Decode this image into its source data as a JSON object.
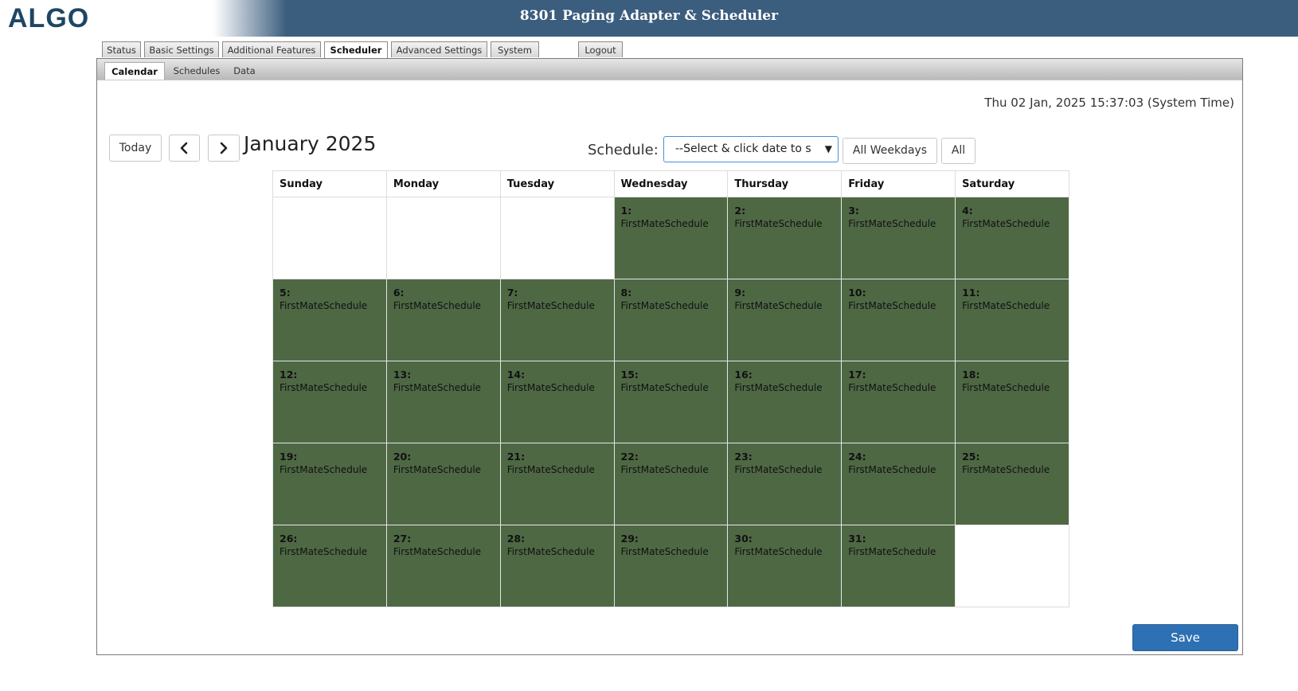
{
  "header": {
    "logo": "ALGO",
    "title": "8301 Paging Adapter & Scheduler"
  },
  "main_tabs": [
    {
      "label": "Status",
      "active": false
    },
    {
      "label": "Basic Settings",
      "active": false
    },
    {
      "label": "Additional Features",
      "active": false
    },
    {
      "label": "Scheduler",
      "active": true
    },
    {
      "label": "Advanced Settings",
      "active": false
    },
    {
      "label": "System",
      "active": false
    },
    {
      "label": "Logout",
      "active": false
    }
  ],
  "sub_tabs": [
    {
      "label": "Calendar",
      "active": true
    },
    {
      "label": "Schedules",
      "active": false
    },
    {
      "label": "Data",
      "active": false
    }
  ],
  "system_time": "Thu 02 Jan, 2025 15:37:03 (System Time)",
  "toolbar": {
    "today_label": "Today",
    "prev_icon": "chevron-left-icon",
    "next_icon": "chevron-right-icon",
    "month_title": "January 2025",
    "schedule_label": "Schedule:",
    "schedule_select_value": "--Select & click date to s",
    "all_weekdays_label": "All Weekdays",
    "all_label": "All"
  },
  "calendar": {
    "weekdays": [
      "Sunday",
      "Monday",
      "Tuesday",
      "Wednesday",
      "Thursday",
      "Friday",
      "Saturday"
    ],
    "weeks": [
      [
        null,
        null,
        null,
        {
          "day": "1:",
          "schedule": "FirstMateSchedule"
        },
        {
          "day": "2:",
          "schedule": "FirstMateSchedule"
        },
        {
          "day": "3:",
          "schedule": "FirstMateSchedule"
        },
        {
          "day": "4:",
          "schedule": "FirstMateSchedule"
        }
      ],
      [
        {
          "day": "5:",
          "schedule": "FirstMateSchedule"
        },
        {
          "day": "6:",
          "schedule": "FirstMateSchedule"
        },
        {
          "day": "7:",
          "schedule": "FirstMateSchedule"
        },
        {
          "day": "8:",
          "schedule": "FirstMateSchedule"
        },
        {
          "day": "9:",
          "schedule": "FirstMateSchedule"
        },
        {
          "day": "10:",
          "schedule": "FirstMateSchedule"
        },
        {
          "day": "11:",
          "schedule": "FirstMateSchedule"
        }
      ],
      [
        {
          "day": "12:",
          "schedule": "FirstMateSchedule"
        },
        {
          "day": "13:",
          "schedule": "FirstMateSchedule"
        },
        {
          "day": "14:",
          "schedule": "FirstMateSchedule"
        },
        {
          "day": "15:",
          "schedule": "FirstMateSchedule"
        },
        {
          "day": "16:",
          "schedule": "FirstMateSchedule"
        },
        {
          "day": "17:",
          "schedule": "FirstMateSchedule"
        },
        {
          "day": "18:",
          "schedule": "FirstMateSchedule"
        }
      ],
      [
        {
          "day": "19:",
          "schedule": "FirstMateSchedule"
        },
        {
          "day": "20:",
          "schedule": "FirstMateSchedule"
        },
        {
          "day": "21:",
          "schedule": "FirstMateSchedule"
        },
        {
          "day": "22:",
          "schedule": "FirstMateSchedule"
        },
        {
          "day": "23:",
          "schedule": "FirstMateSchedule"
        },
        {
          "day": "24:",
          "schedule": "FirstMateSchedule"
        },
        {
          "day": "25:",
          "schedule": "FirstMateSchedule"
        }
      ],
      [
        {
          "day": "26:",
          "schedule": "FirstMateSchedule"
        },
        {
          "day": "27:",
          "schedule": "FirstMateSchedule"
        },
        {
          "day": "28:",
          "schedule": "FirstMateSchedule"
        },
        {
          "day": "29:",
          "schedule": "FirstMateSchedule"
        },
        {
          "day": "30:",
          "schedule": "FirstMateSchedule"
        },
        {
          "day": "31:",
          "schedule": "FirstMateSchedule"
        },
        null
      ]
    ]
  },
  "save_label": "Save",
  "colors": {
    "header_bg": "#3b5d7e",
    "scheduled_day_bg": "#4e6844",
    "save_button_bg": "#2d70b3",
    "select_focus_border": "#4a8fd6"
  }
}
